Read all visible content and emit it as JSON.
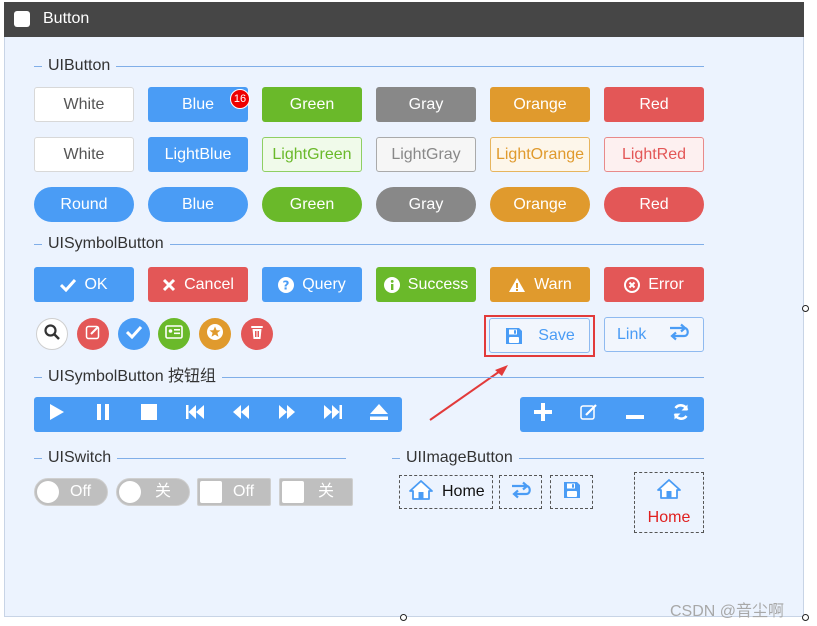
{
  "window": {
    "title": "Button"
  },
  "groups": {
    "ui_button": "UIButton",
    "ui_symbol_button": "UISymbolButton",
    "ui_symbol_button_group": "UISymbolButton 按钮组",
    "ui_switch": "UISwitch",
    "ui_image_button": "UIImageButton"
  },
  "row1": [
    "White",
    "Blue",
    "Green",
    "Gray",
    "Orange",
    "Red"
  ],
  "row1_badge": "16",
  "row2": [
    "White",
    "LightBlue",
    "LightGreen",
    "LightGray",
    "LightOrange",
    "LightRed"
  ],
  "row3": [
    "Round",
    "Blue",
    "Green",
    "Gray",
    "Orange",
    "Red"
  ],
  "symbol_buttons": [
    "OK",
    "Cancel",
    "Query",
    "Success",
    "Warn",
    "Error"
  ],
  "save_label": "Save",
  "link_label": "Link",
  "switches": [
    "Off",
    "关",
    "Off",
    "关"
  ],
  "image_buttons": {
    "home_label": "Home",
    "home_label_2": "Home"
  },
  "watermark": "CSDN @音尘啊",
  "colors": {
    "blue": "#4a9cf5",
    "green": "#6ab92a",
    "gray": "#888888",
    "orange": "#e09a2d",
    "red": "#e35757",
    "title_bar": "#464646",
    "background": "#ecf3fe"
  }
}
